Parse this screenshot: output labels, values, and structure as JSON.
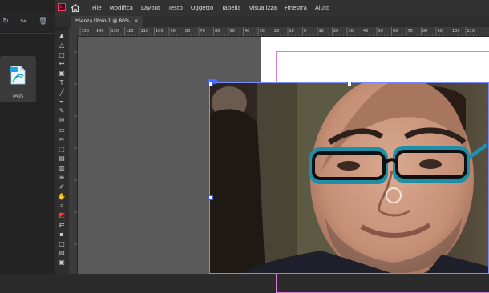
{
  "background_window": {
    "file_tile": {
      "label": "PSD",
      "icon": "psd-file-icon"
    }
  },
  "app": {
    "name": "InDesign",
    "menu": [
      "File",
      "Modifica",
      "Layout",
      "Testo",
      "Oggetto",
      "Tabella",
      "Visualizza",
      "Finestra",
      "Aiuto"
    ],
    "document_tab": {
      "title": "*Senza titolo-1 @ 80%",
      "close": "×"
    },
    "ruler_ticks": [
      "150",
      "140",
      "130",
      "120",
      "110",
      "100",
      "90",
      "80",
      "70",
      "60",
      "50",
      "40",
      "30",
      "20",
      "10",
      "0",
      "10",
      "20",
      "30",
      "40",
      "50",
      "60",
      "70",
      "80",
      "90",
      "100",
      "110"
    ],
    "tools": [
      "selection-icon",
      "direct-selection-icon",
      "page-tool-icon",
      "gap-tool-icon",
      "content-collector-icon",
      "type-icon",
      "line-icon",
      "pen-icon",
      "pencil-icon",
      "rectangle-frame-icon",
      "rectangle-icon",
      "scissors-icon",
      "free-transform-icon",
      "gradient-swatch-icon",
      "gradient-feather-icon",
      "note-icon",
      "eyedropper-icon",
      "hand-icon",
      "zoom-icon",
      "fill-stroke-icon",
      "swap-icon",
      "default-colors-icon",
      "formatting-icon",
      "apply-color-icon",
      "view-mode-icon"
    ]
  },
  "colors": {
    "accent": "#ff3366",
    "frame": "#7a8cff",
    "margin": "#d97dd9"
  }
}
